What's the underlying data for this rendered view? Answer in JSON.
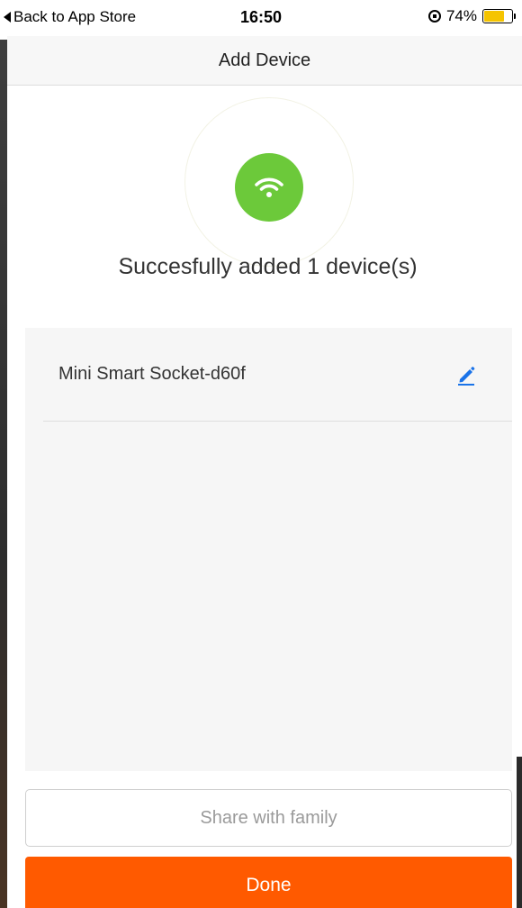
{
  "status_bar": {
    "back_label": "Back to App Store",
    "time": "16:50",
    "battery_percent": "74%",
    "battery_level": 0.74
  },
  "nav": {
    "title": "Add Device"
  },
  "success": {
    "message": "Succesfully added 1 device(s)",
    "icon": "wifi-icon",
    "icon_color": "#6cc93a"
  },
  "devices": [
    {
      "name": "Mini Smart Socket-d60f",
      "edit_icon": "pencil-icon",
      "edit_color": "#1a73e8"
    }
  ],
  "buttons": {
    "share_label": "Share with family",
    "done_label": "Done",
    "done_color": "#ff5a00"
  }
}
